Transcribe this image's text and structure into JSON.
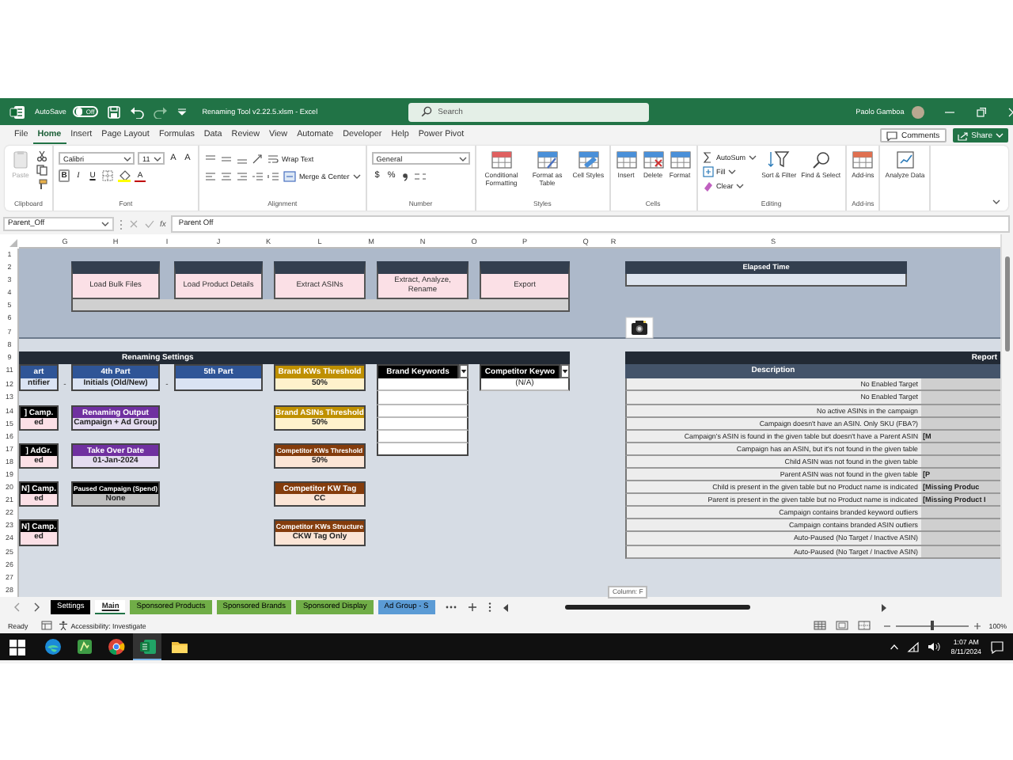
{
  "title_bar": {
    "autosave_label": "AutoSave",
    "autosave": {
      "on": false,
      "label": "Off"
    },
    "title": "Renaming Tool v2.22.5.xlsm  -  Excel",
    "search": {
      "placeholder": "Search"
    },
    "user": "Paolo Gamboa"
  },
  "menu_tabs": [
    {
      "label": "File",
      "selected": false
    },
    {
      "label": "Home",
      "selected": true
    },
    {
      "label": "Insert",
      "selected": false
    },
    {
      "label": "Page Layout",
      "selected": false
    },
    {
      "label": "Formulas",
      "selected": false
    },
    {
      "label": "Data",
      "selected": false
    },
    {
      "label": "Review",
      "selected": false
    },
    {
      "label": "View",
      "selected": false
    },
    {
      "label": "Automate",
      "selected": false
    },
    {
      "label": "Developer",
      "selected": false
    },
    {
      "label": "Help",
      "selected": false
    },
    {
      "label": "Power Pivot",
      "selected": false
    }
  ],
  "comments_button": "Comments",
  "share_button": "Share",
  "ribbon_groups": [
    {
      "kind": "clipboard",
      "label": "Clipboard",
      "large": [
        "Paste"
      ]
    },
    {
      "kind": "font",
      "label": "Font",
      "font_name": "Calibri",
      "font_size": "11",
      "size_buttons": [
        "A",
        "A"
      ],
      "styles": [
        "B",
        "I",
        "U"
      ],
      "font_color": "A"
    },
    {
      "kind": "alignment",
      "label": "Alignment",
      "small": [
        "Wrap Text",
        "Merge & Center"
      ]
    },
    {
      "kind": "number",
      "label": "Number",
      "format": "General",
      "symbols": [
        "$",
        "%"
      ]
    },
    {
      "kind": "large",
      "label": "Styles",
      "large": [
        "Conditional Formatting",
        "Format as Table",
        "Cell Styles"
      ]
    },
    {
      "kind": "large",
      "label": "Cells",
      "large": [
        "Insert",
        "Delete",
        "Format"
      ]
    },
    {
      "kind": "editing",
      "label": "Editing",
      "small": [
        "AutoSum",
        "Fill",
        "Clear"
      ],
      "large": [
        "Sort & Filter",
        "Find & Select"
      ]
    },
    {
      "kind": "large",
      "label": "Add-ins",
      "large": [
        "Add-ins"
      ]
    },
    {
      "kind": "large",
      "large": [
        "Analyze Data"
      ]
    }
  ],
  "formula_bar": {
    "name_box": "Parent_Off",
    "function_label": "fx",
    "formula": "Parent Off"
  },
  "column_headers": [
    "G",
    "H",
    "I",
    "J",
    "K",
    "L",
    "M",
    "N",
    "O",
    "P",
    "Q",
    "R",
    "S"
  ],
  "row_headers": [
    "1",
    "2",
    "3",
    "4",
    "5",
    "6",
    "7",
    "8",
    "9",
    "11",
    "12",
    "13",
    "14",
    "15",
    "16",
    "17",
    "18",
    "19",
    "20",
    "21",
    "22",
    "23",
    "24",
    "25",
    "26",
    "27",
    "28"
  ],
  "action_buttons": [
    "Load Bulk Files",
    "Load Product Details",
    "Extract ASINs",
    "Extract, Analyze, Rename",
    "Export"
  ],
  "elapsed_time": {
    "label": "Elapsed Time"
  },
  "settings": {
    "title": "Renaming Settings",
    "joiners": [
      "-",
      "-"
    ],
    "columns": [
      {
        "fields": [
          {
            "kind": "part",
            "header": "art",
            "value": "ntifier",
            "color": "#2f5597"
          },
          {
            "kind": "input",
            "header": "] Camp.",
            "value": "ed",
            "color": "#000000"
          },
          {
            "kind": "input",
            "header": "] AdGr.",
            "value": "ed",
            "color": "#000000"
          },
          {
            "kind": "input",
            "header": "N] Camp.",
            "value": "ed",
            "color": "#000000"
          },
          {
            "kind": "input",
            "header": "N] Camp.",
            "value": "ed",
            "color": "#000000"
          }
        ]
      },
      {
        "fields": [
          {
            "kind": "part",
            "header": "4th Part",
            "value": "Initials (Old/New)",
            "color": "#2f5597"
          },
          {
            "kind": "option",
            "header": "Renaming Output",
            "value": "Campaign + Ad Group",
            "color": "#7030a0"
          },
          {
            "kind": "option",
            "header": "Take Over Date",
            "value": "01-Jan-2024",
            "color": "#7030a0"
          },
          {
            "kind": "fixed",
            "header": "Paused Campaign (Spend)",
            "value": "None",
            "color": "#000000"
          }
        ]
      },
      {
        "fields": [
          {
            "kind": "part",
            "header": "5th Part",
            "color": "#2f5597"
          }
        ]
      },
      {
        "fields": [
          {
            "kind": "threshold",
            "header": "Brand KWs Threshold",
            "value": "50%",
            "color": "#bf9000"
          },
          {
            "kind": "threshold",
            "header": "Brand ASINs Threshold",
            "value": "50%",
            "color": "#bf9000"
          },
          {
            "kind": "setting",
            "header": "Competitor KWs Threshold",
            "value": "50%",
            "color": "#843c0c"
          },
          {
            "kind": "setting",
            "header": "Competitor KW Tag",
            "value": "CC",
            "color": "#843c0c"
          },
          {
            "kind": "setting",
            "header": "Competitor KWs Structure",
            "value": "CKW Tag Only",
            "color": "#843c0c"
          }
        ]
      },
      {
        "fields": [
          {
            "kind": "list",
            "header": "Brand Keywords",
            "color": "#000000"
          }
        ]
      },
      {
        "fields": [
          {
            "kind": "filter",
            "header": "Competitor Keywo",
            "value": "(N/A)",
            "color": "#000000"
          }
        ]
      }
    ]
  },
  "report": {
    "title": "Report",
    "header": "Description",
    "rows": [
      {
        "description": "No Enabled Target"
      },
      {
        "description": "No Enabled Target"
      },
      {
        "description": "No active ASINs in the campaign"
      },
      {
        "description": "Campaign doesn't have an ASIN. Only SKU (FBA?)"
      },
      {
        "description": "Campaign's ASIN is found in the given table but doesn't have a Parent ASIN",
        "value": "[M"
      },
      {
        "description": "Campaign has an ASIN, but it's not found in the given table"
      },
      {
        "description": "Child ASIN was not found in the given table"
      },
      {
        "description": "Parent ASIN was not found in the given table",
        "value": "[P"
      },
      {
        "description": "Child is present in the given table but no Product name is indicated",
        "value": "[Missing Produc"
      },
      {
        "description": "Parent is present in the given table but no Product name is indicated",
        "value": "[Missing Product I"
      },
      {
        "description": "Campaign contains branded keyword outliers"
      },
      {
        "description": "Campaign contains branded ASIN outliers"
      },
      {
        "description": "Auto-Paused (No Target / Inactive ASIN)"
      },
      {
        "description": "Auto-Paused (No Target / Inactive ASIN)"
      }
    ]
  },
  "sheet_tabs": [
    {
      "label": "Settings",
      "selected": false,
      "color": "#000000"
    },
    {
      "label": "Main",
      "selected": true
    },
    {
      "label": "Sponsored Products",
      "selected": false,
      "color": "#70ad47"
    },
    {
      "label": "Sponsored Brands",
      "selected": false,
      "color": "#70ad47"
    },
    {
      "label": "Sponsored Display",
      "selected": false,
      "color": "#70ad47"
    },
    {
      "label": "Ad Group - S",
      "selected": false,
      "color": "#5b9bd5"
    }
  ],
  "tooltip": "Column: F",
  "status_bar": {
    "ready": "Ready",
    "accessibility": "Accessibility: Investigate",
    "zoom_slider": {
      "level": 0.5
    },
    "zoom": "100%"
  },
  "taskbar": {
    "apps": [
      {
        "kind": "edge",
        "selected": false
      },
      {
        "kind": "notes",
        "selected": false
      },
      {
        "kind": "chrome",
        "selected": false
      },
      {
        "kind": "excel",
        "selected": true
      },
      {
        "kind": "folder",
        "selected": false
      }
    ],
    "time": "1:07 AM",
    "date": "8/11/2024"
  }
}
